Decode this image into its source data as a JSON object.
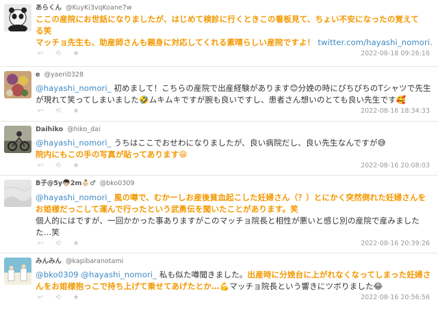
{
  "tweets": [
    {
      "name": "あらくん",
      "handle": "@KuyKi3vqKoane7w",
      "lines": [
        [
          {
            "t": "hl",
            "v": "ここの産院にお世話になりましたが、はじめて検診に行くときこの看板見て、ちょい不安になったの覚えて"
          }
        ],
        [
          {
            "t": "hl",
            "v": "る笑"
          }
        ],
        [
          {
            "t": "hl",
            "v": "マッチョ先生も、助産師さんも親身に対応してくれる素晴らしい産院ですよ！ "
          },
          {
            "t": "link",
            "v": "twitter.com/hayashi_nomori…"
          }
        ]
      ],
      "date": "2022-08-18 09:26:16",
      "avatar_colors": [
        "#2b2b2b",
        "#f2f2f2"
      ]
    },
    {
      "name": "e",
      "handle": "@yaeri0328",
      "lines": [
        [
          {
            "t": "mention",
            "v": "@hayashi_nomori_"
          },
          {
            "t": "plain",
            "v": " 初めまして！こちらの産院で出産経験があります😊分娩の時にぴちぴちのTシャツで先生"
          }
        ],
        [
          {
            "t": "plain",
            "v": "が現れて笑ってしまいました🤣ムキムキですが腕も良いですし、患者さん想いのとても良い先生です🥰"
          }
        ]
      ],
      "date": "2022-08-16 18:34:33",
      "avatar_colors": [
        "#c9a27a",
        "#8a4a7a"
      ]
    },
    {
      "name": "Daihiko",
      "handle": "@hiko_dai",
      "lines": [
        [
          {
            "t": "mention",
            "v": "@hayashi_nomori_"
          },
          {
            "t": "plain",
            "v": " うちはここでおせわになりましたが、良い病院だし、良い先生なんですが😅"
          }
        ],
        [
          {
            "t": "hl",
            "v": "院内にもこの手の写真が貼ってあります😁"
          }
        ]
      ],
      "date": "2022-08-16 20:08:03",
      "avatar_colors": [
        "#6b6b5a",
        "#a8a896"
      ]
    },
    {
      "name": "B子@5y👦🏻2m👶🏻♂",
      "handle": "@bko0309",
      "lines": [
        [
          {
            "t": "mention",
            "v": "@hayashi_nomori_"
          },
          {
            "t": "hl",
            "v": " 風の噂で、むかーしお産後貧血起こした妊婦さん（？）とにかく突然倒れた妊婦さんを"
          }
        ],
        [
          {
            "t": "hl",
            "v": "お姫様だっこして運んで行ったという武勇伝を聞いたことがあります。笑"
          }
        ],
        [
          {
            "t": "plain",
            "v": "個人的にはですが、一回かかった事ありますがこのマッチョ院長と相性が悪いと感じ別の産院で産みました"
          }
        ],
        [
          {
            "t": "plain",
            "v": "た…笑"
          }
        ]
      ],
      "date": "2022-08-16 20:39:26",
      "avatar_colors": [
        "#e8e8e8",
        "#d0d0d0"
      ]
    },
    {
      "name": "みんみん",
      "handle": "@kapibaranotami",
      "lines": [
        [
          {
            "t": "mention",
            "v": "@bko0309 @hayashi_nomori_"
          },
          {
            "t": "plain",
            "v": " 私も似た噂聞きました。"
          },
          {
            "t": "hl",
            "v": "出産時に分娩台に上がれなくなってしまった妊婦さ"
          }
        ],
        [
          {
            "t": "hl",
            "v": "んをお姫様抱っこで持ち上げて乗せてあげたとか…"
          },
          {
            "t": "plain",
            "v": "💪マッチョ院長という響きにツボりました😂"
          }
        ]
      ],
      "date": "2022-08-16 20:56:56",
      "avatar_colors": [
        "#7fc0d6",
        "#f4f0e0"
      ]
    }
  ],
  "actions": [
    "reply-icon",
    "retweet-icon",
    "like-icon"
  ],
  "colors": {
    "highlight": "#f39800",
    "link": "#3b88c3",
    "meta": "#999999"
  }
}
